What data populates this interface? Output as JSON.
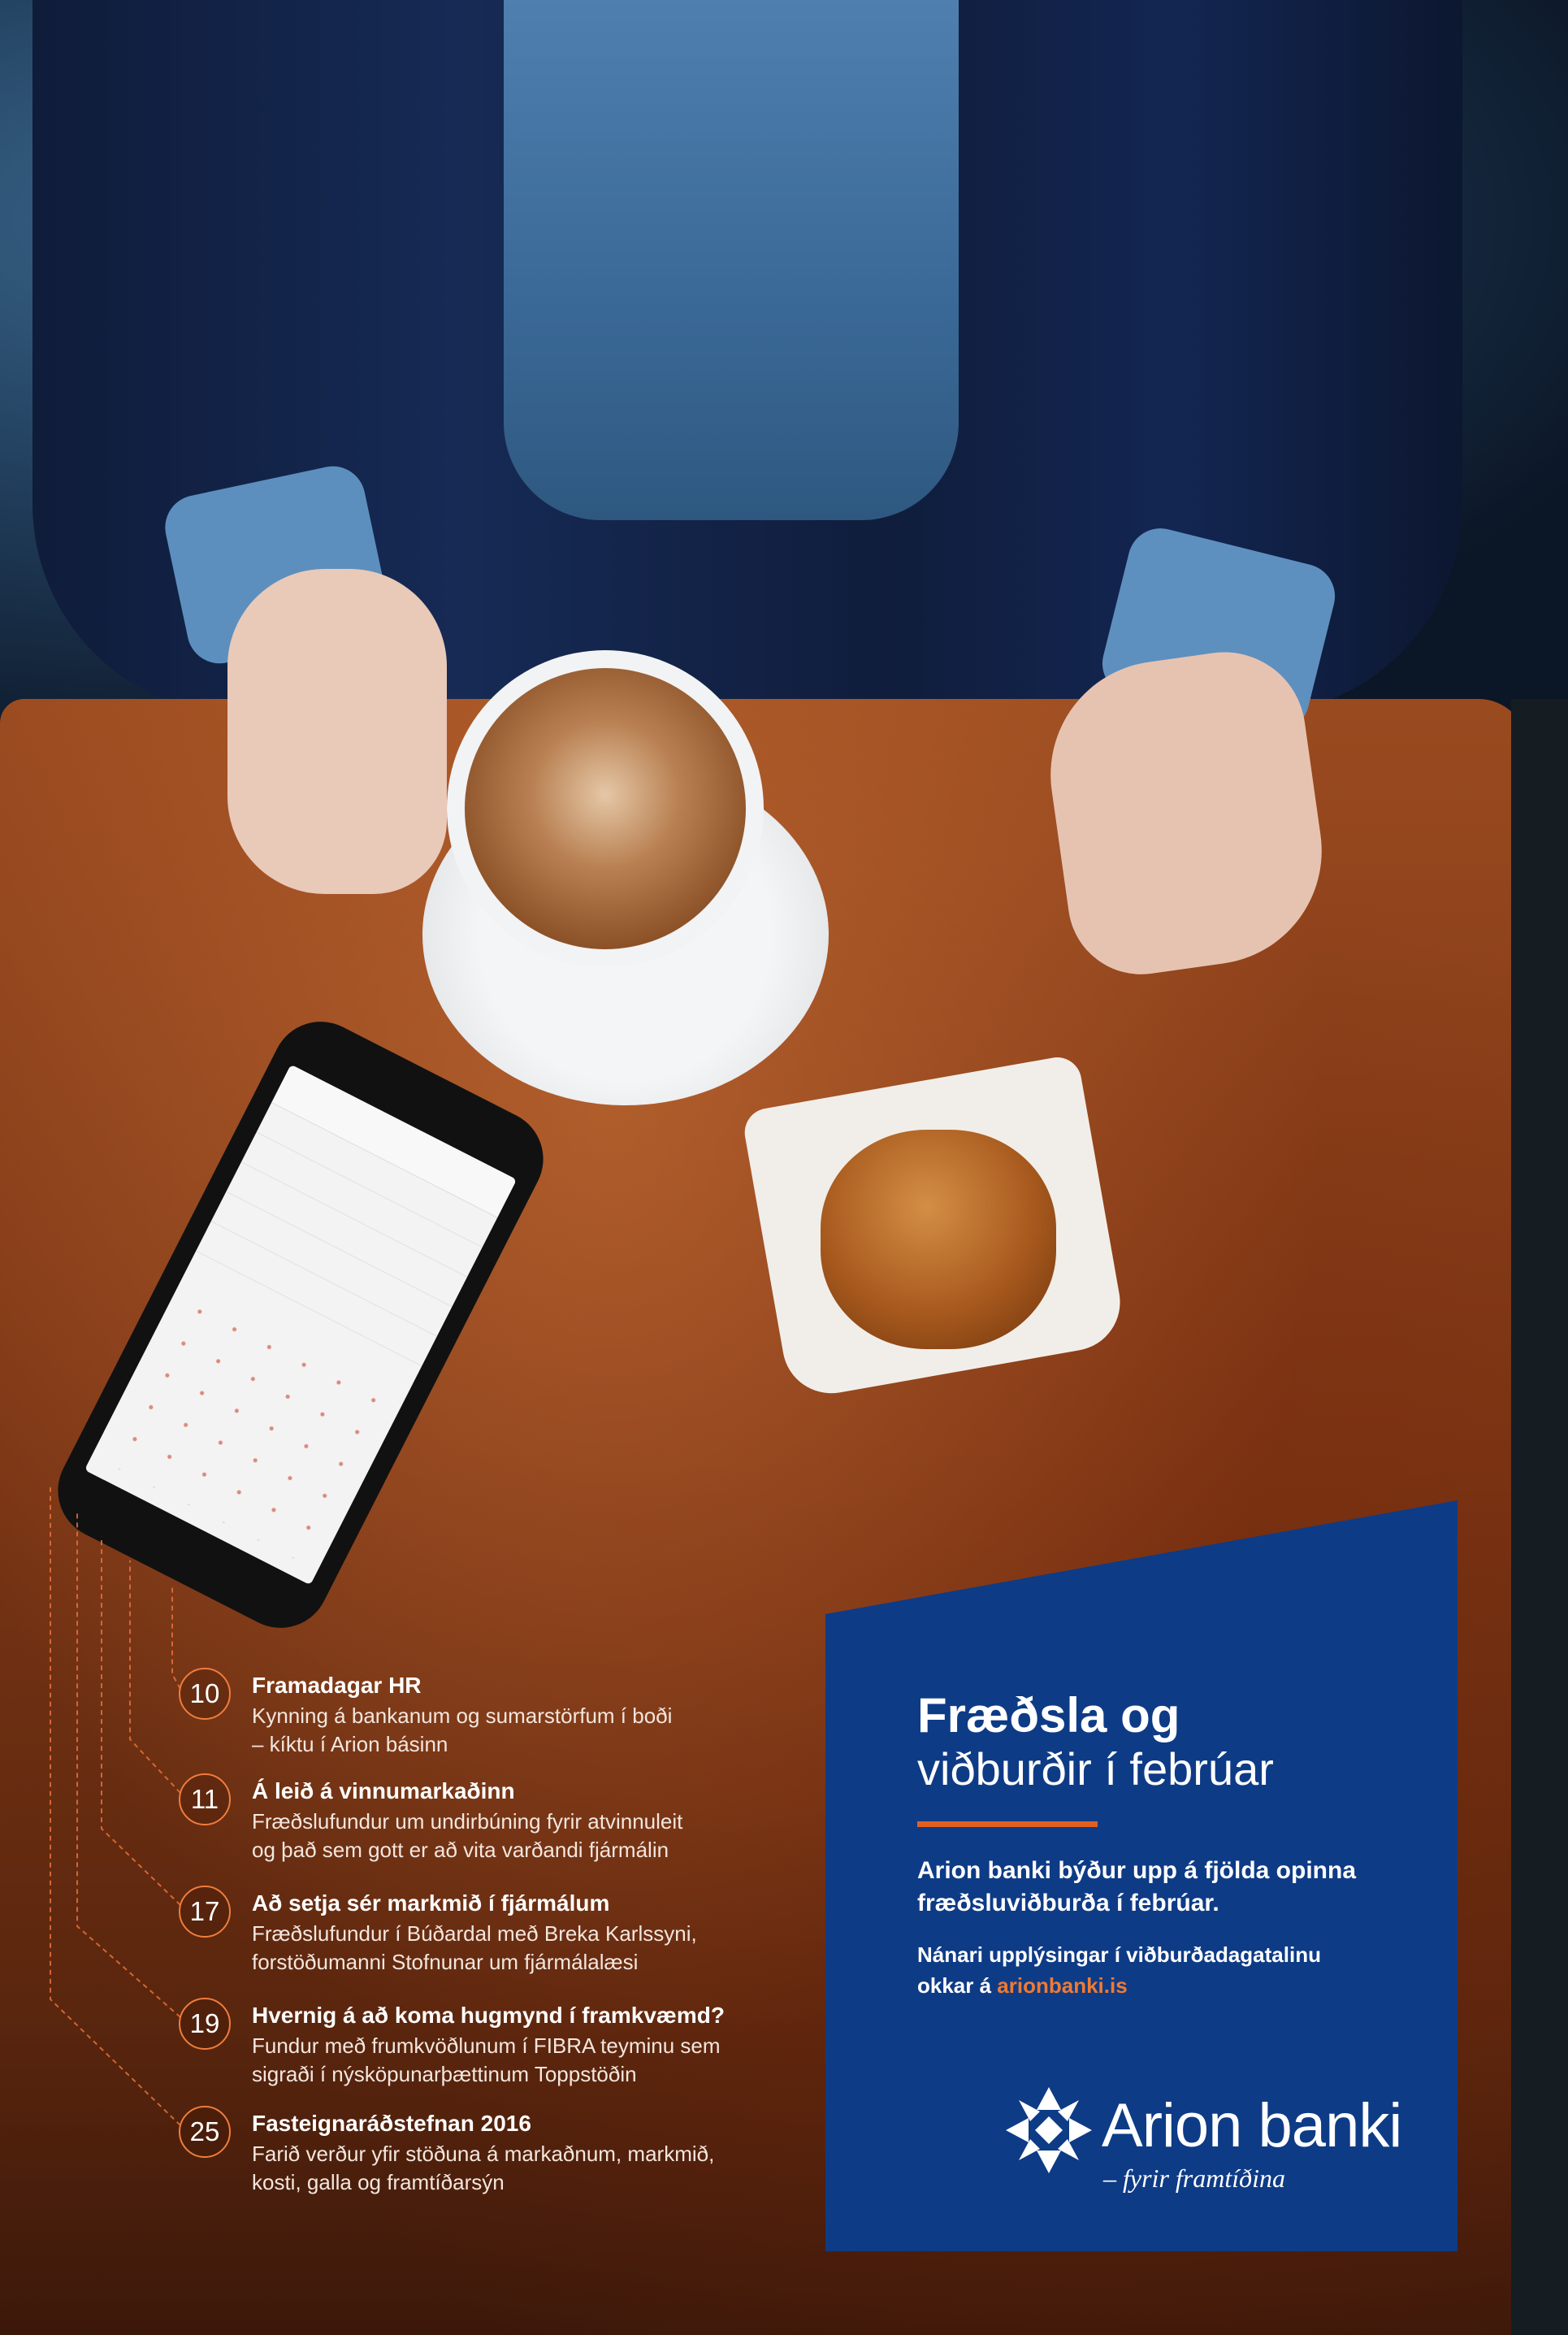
{
  "events": [
    {
      "day": "10",
      "title": "Framadagar HR",
      "desc_line1": "Kynning á bankanum og sumarstörfum í boði",
      "desc_line2": "– kíktu í Arion básinn"
    },
    {
      "day": "11",
      "title": "Á leið á vinnumarkaðinn",
      "desc_line1": "Fræðslufundur um undirbúning fyrir atvinnuleit",
      "desc_line2": "og það sem gott er að vita varðandi fjármálin"
    },
    {
      "day": "17",
      "title": "Að setja sér markmið í fjármálum",
      "desc_line1": "Fræðslufundur í Búðardal með Breka Karlssyni,",
      "desc_line2": "forstöðumanni Stofnunar um fjármálalæsi"
    },
    {
      "day": "19",
      "title": "Hvernig á að koma hugmynd í framkvæmd?",
      "desc_line1": "Fundur með frumkvöðlunum í FIBRA teyminu sem",
      "desc_line2": "sigraði í nýsköpunarþættinum Toppstöðin"
    },
    {
      "day": "25",
      "title": "Fasteignaráðstefnan 2016",
      "desc_line1": "Farið verður yfir stöðuna á markaðnum, markmið,",
      "desc_line2": " kosti, galla og framtíðarsýn"
    }
  ],
  "panel": {
    "title_line1": "Fræðsla og",
    "title_line2": "viðburðir í febrúar",
    "lead_line1": "Arion banki býður upp á fjölda opinna",
    "lead_line2": "fræðsluviðburða í febrúar.",
    "more_line1": "Nánari upplýsingar í viðburðadagatalinu",
    "more_prefix": "okkar á ",
    "more_link": "arionbanki.is"
  },
  "logo": {
    "name": "Arion banki",
    "tagline": "– fyrir framtíðina"
  },
  "colors": {
    "panel_blue": "#0e3b86",
    "accent_orange": "#e2601f",
    "ring_orange": "#ef7d3c"
  }
}
